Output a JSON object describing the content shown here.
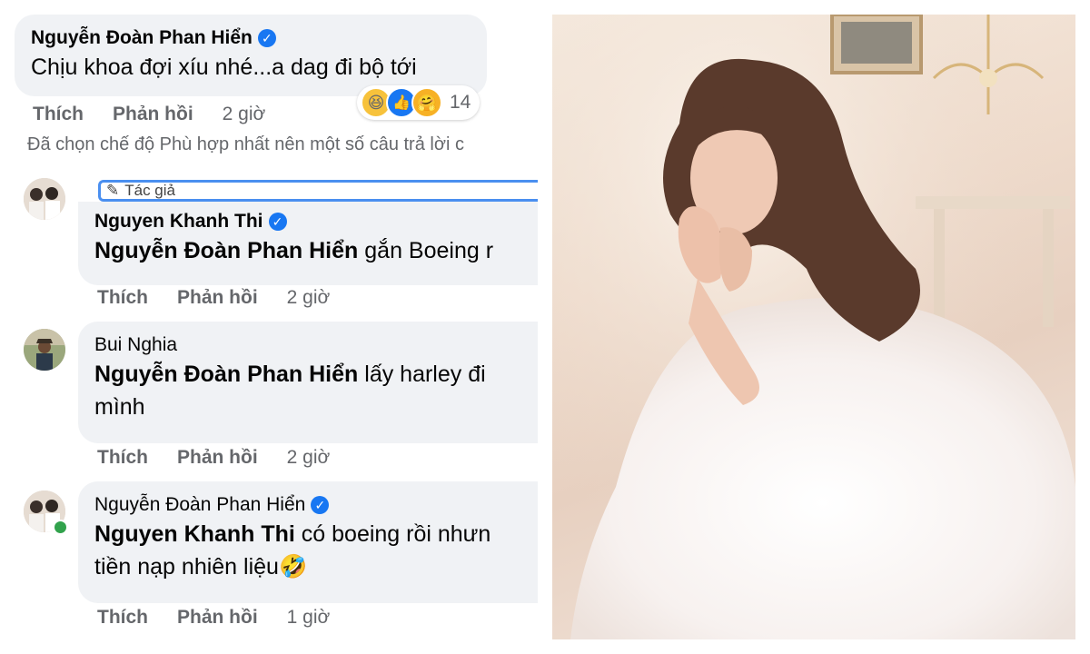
{
  "comments": [
    {
      "author": "Nguyễn Đoàn Phan Hiển",
      "verified": true,
      "lines": [
        "Chịu khoa đợi xíu nhé...a dag đi bộ tới"
      ],
      "actions": {
        "like": "Thích",
        "reply": "Phản hồi",
        "time": "2 giờ"
      },
      "reactions": {
        "icons": [
          "haha-icon",
          "like-icon",
          "care-icon"
        ],
        "count": "14"
      }
    },
    {
      "author": "Nguyen Khanh Thi",
      "verified": true,
      "badge": "Tác giả",
      "mention": "Nguyễn Đoàn Phan Hiển",
      "text": "gắn Boeing r",
      "actions": {
        "like": "Thích",
        "reply": "Phản hồi",
        "time": "2 giờ"
      }
    },
    {
      "author": "Bui Nghia",
      "verified": false,
      "mention": "Nguyễn Đoàn Phan Hiển",
      "text": "lấy harley đi",
      "line2": "mình",
      "actions": {
        "like": "Thích",
        "reply": "Phản hồi",
        "time": "2 giờ"
      }
    },
    {
      "author": "Nguyễn Đoàn Phan Hiển",
      "verified": true,
      "mention": "Nguyen Khanh Thi",
      "text": "có boeing rồi nhưn",
      "line2": "tiền nạp nhiên liệu",
      "actions": {
        "like": "Thích",
        "reply": "Phản hồi",
        "time": "1 giờ"
      }
    }
  ],
  "notice": "Đã chọn chế độ Phù hợp nhất nên một số câu trả lời c",
  "colors": {
    "accent": "#1877f2",
    "bubble": "#f0f2f5",
    "muted": "#65676b"
  }
}
